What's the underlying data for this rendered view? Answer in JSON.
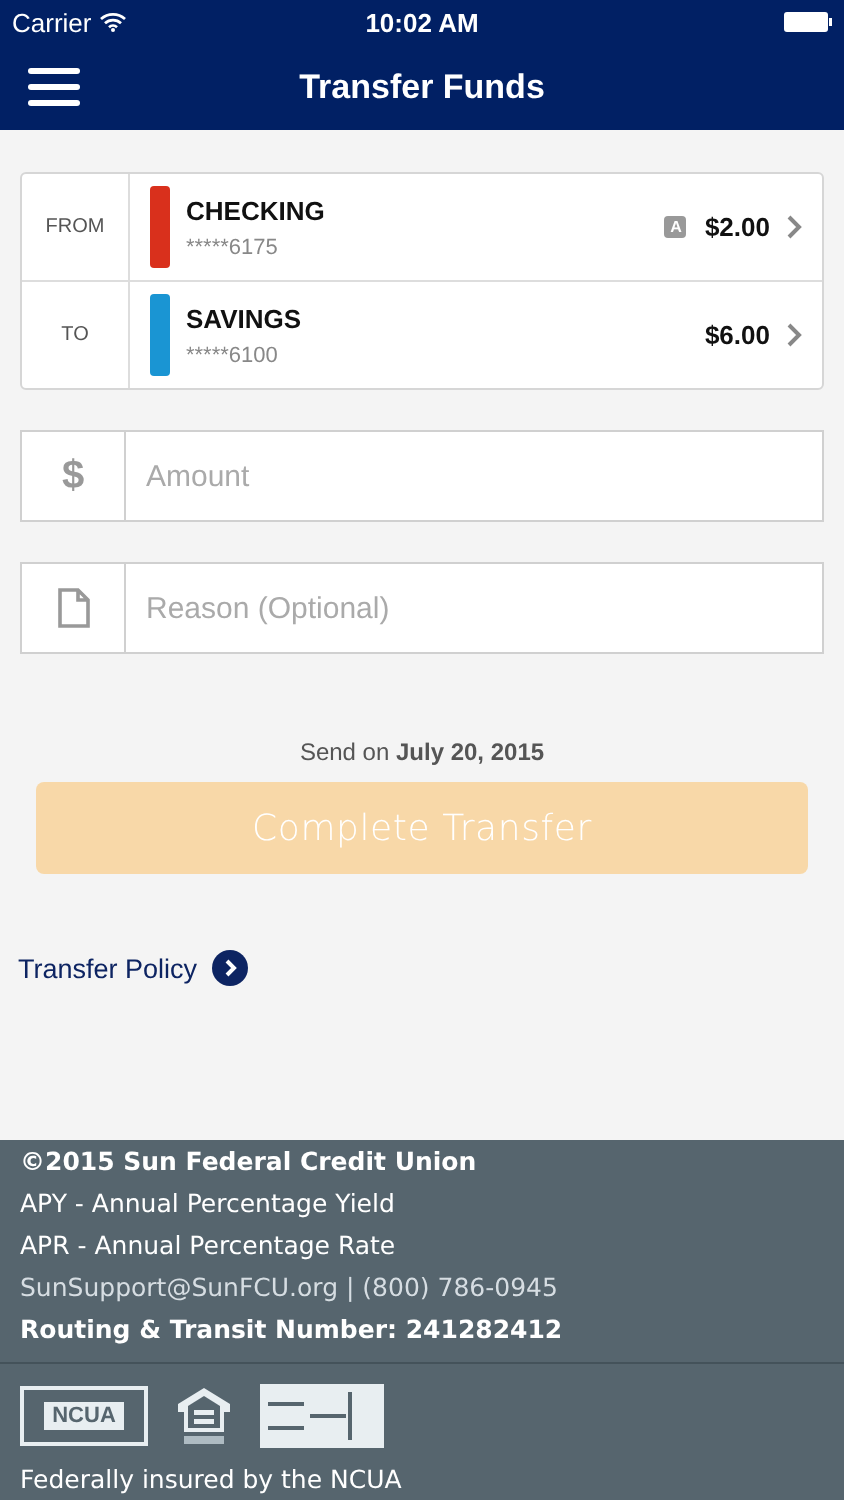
{
  "status_bar": {
    "carrier": "Carrier",
    "time": "10:02 AM"
  },
  "nav": {
    "title": "Transfer Funds"
  },
  "accounts": [
    {
      "role": "FROM",
      "name": "CHECKING",
      "number": "*****6175",
      "color": "#d9301c",
      "badge": "A",
      "amount": "$2.00"
    },
    {
      "role": "TO",
      "name": "SAVINGS",
      "number": "*****6100",
      "color": "#1a95d3",
      "amount": "$6.00"
    }
  ],
  "fields": [
    {
      "kind": "amount",
      "icon": "$",
      "placeholder": "Amount"
    },
    {
      "kind": "reason",
      "placeholder": "Reason (Optional)"
    }
  ],
  "send_on": "Send on **July 20, 2015**",
  "complete_button": {
    "label": "Complete Transfer",
    "disabled": true
  },
  "policy_link": "Transfer Policy",
  "footer": {
    "copyright": "©2015 Sun Federal Credit Union",
    "apy": "APY - Annual Percentage Yield",
    "apr": "APR - Annual Percentage Rate",
    "contact": "SunSupport@SunFCU.org | (800) 786-0945",
    "routing": "Routing & Transit Number: 241282412",
    "ncua_logo": "NCUA",
    "insured": "Federally insured by the NCUA"
  }
}
